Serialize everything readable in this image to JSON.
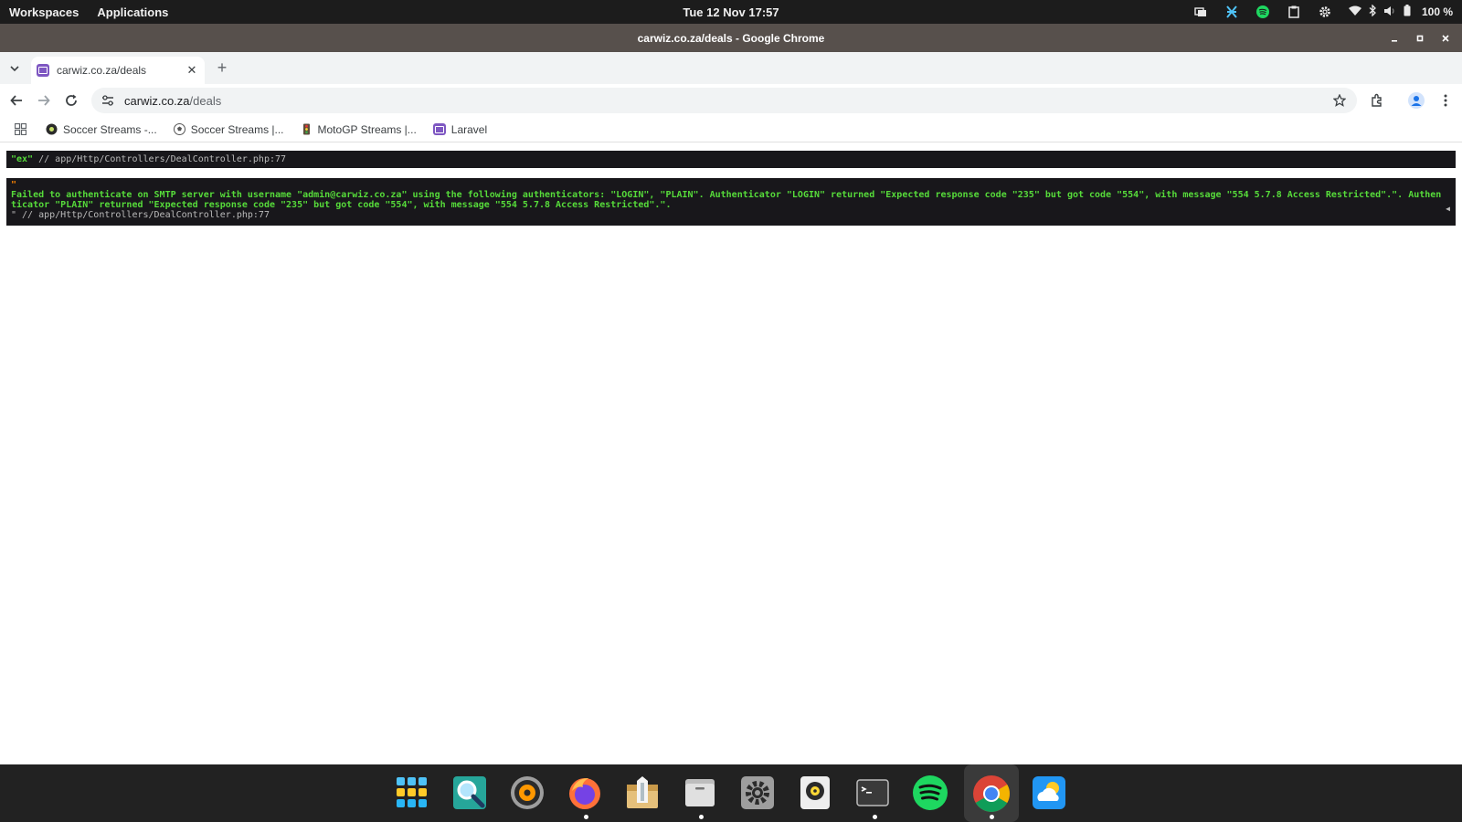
{
  "topbar": {
    "workspaces": "Workspaces",
    "applications": "Applications",
    "clock": "Tue 12 Nov  17:57",
    "battery": "100 %"
  },
  "window": {
    "title": "carwiz.co.za/deals - Google Chrome"
  },
  "tab": {
    "label": "carwiz.co.za/deals"
  },
  "omnibox": {
    "host": "carwiz.co.za",
    "path": "/deals"
  },
  "bookmarks": [
    {
      "label": "Soccer Streams -..."
    },
    {
      "label": "Soccer Streams |..."
    },
    {
      "label": "MotoGP Streams |..."
    },
    {
      "label": "Laravel"
    }
  ],
  "dump": {
    "first_key": "\"ex\"",
    "first_path": " // app/Http/Controllers/DealController.php:77",
    "open_quote": "\"",
    "message_line1": "Failed to authenticate on SMTP server with username \"admin@carwiz.co.za\" using the following authenticators: \"LOGIN\", \"PLAIN\". Authenticator \"LOGIN\" returned \"Expected response code \"235\" but got code \"554\", with message \"554 5.7.8 Access Restricted\".\". Authen",
    "message_line2": "ticator \"PLAIN\" returned \"Expected response code \"235\" but got code \"554\", with message \"554 5.7.8 Access Restricted\".\".",
    "close_path": "\" // app/Http/Controllers/DealController.php:77",
    "collapse_arrow": "◀"
  },
  "colors": {
    "dump_bg": "#18171b",
    "dump_key": "#56db3a",
    "dump_quote": "#ff8400",
    "titlebar": "#57504c",
    "topbar": "#1c1c1c",
    "dock": "#222222"
  }
}
